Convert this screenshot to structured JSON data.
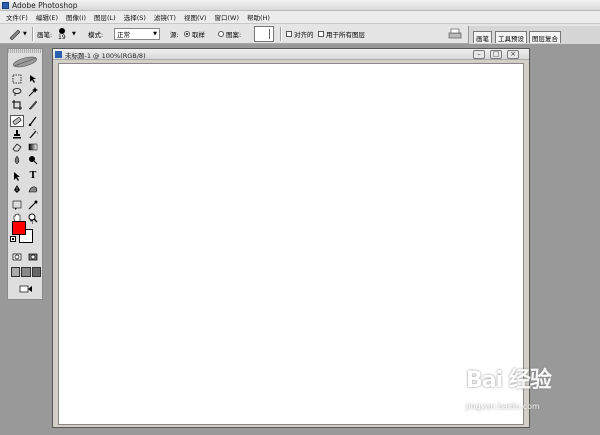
{
  "app": {
    "title": "Adobe Photoshop"
  },
  "menu": [
    "文件(F)",
    "编辑(E)",
    "图像(I)",
    "图层(L)",
    "选择(S)",
    "滤镜(T)",
    "视图(V)",
    "窗口(W)",
    "帮助(H)"
  ],
  "options": {
    "brush_label": "画笔:",
    "brush_size": "19",
    "mode_label": "模式:",
    "mode_value": "正常",
    "source_label": "源:",
    "sampled_label": "取样",
    "pattern_label": "图案:",
    "aligned_label": "对齐的",
    "all_layers_label": "用于所有图层"
  },
  "palette_well": {
    "tabs": [
      "画笔",
      "工具预设",
      "图层复合"
    ]
  },
  "document": {
    "title": "未标题-1 @ 100%(RGB/8)"
  },
  "colors": {
    "foreground": "#ff0000",
    "background": "#ffffff"
  },
  "watermark": {
    "logo": "Bai 经验",
    "url": "jingyan.baidu.com"
  }
}
